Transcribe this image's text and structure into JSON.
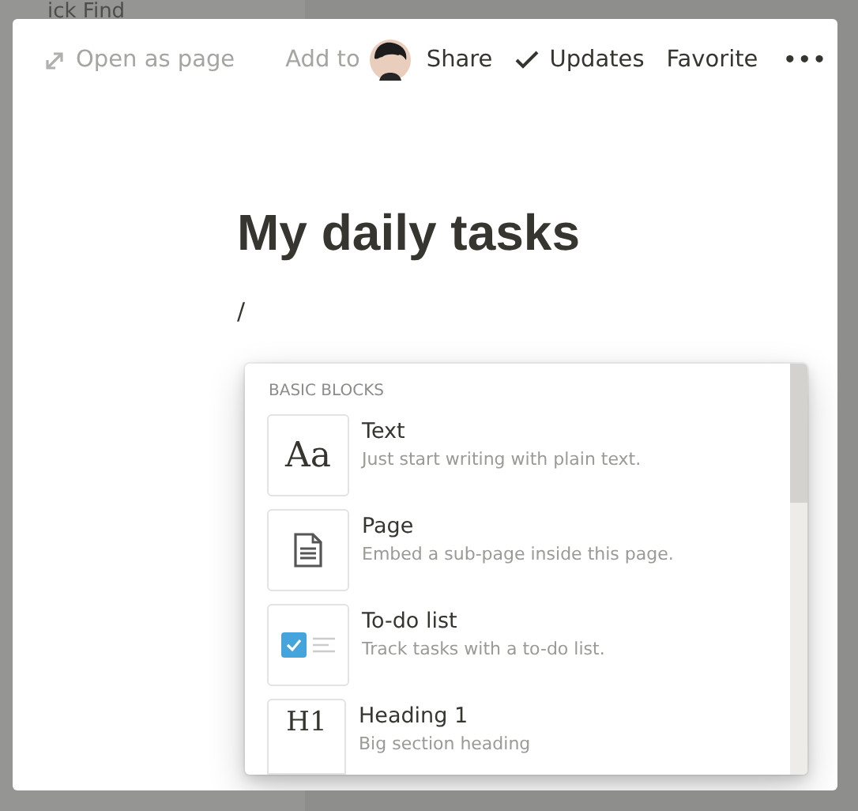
{
  "sidebar_fragments": [
    "ick Find"
  ],
  "topbar": {
    "open_as_page": "Open as page",
    "add_to": "Add to",
    "share": "Share",
    "updates": "Updates",
    "favorite": "Favorite",
    "more": "•••"
  },
  "page": {
    "title": "My daily tasks",
    "input": "/"
  },
  "menu": {
    "section": "BASIC BLOCKS",
    "items": [
      {
        "kind": "text",
        "icon_label": "Aa",
        "title": "Text",
        "description": "Just start writing with plain text."
      },
      {
        "kind": "page",
        "title": "Page",
        "description": "Embed a sub-page inside this page."
      },
      {
        "kind": "todo",
        "title": "To-do list",
        "description": "Track tasks with a to-do list."
      },
      {
        "kind": "heading",
        "icon_label": "H1",
        "title": "Heading 1",
        "description": "Big section heading"
      }
    ]
  }
}
